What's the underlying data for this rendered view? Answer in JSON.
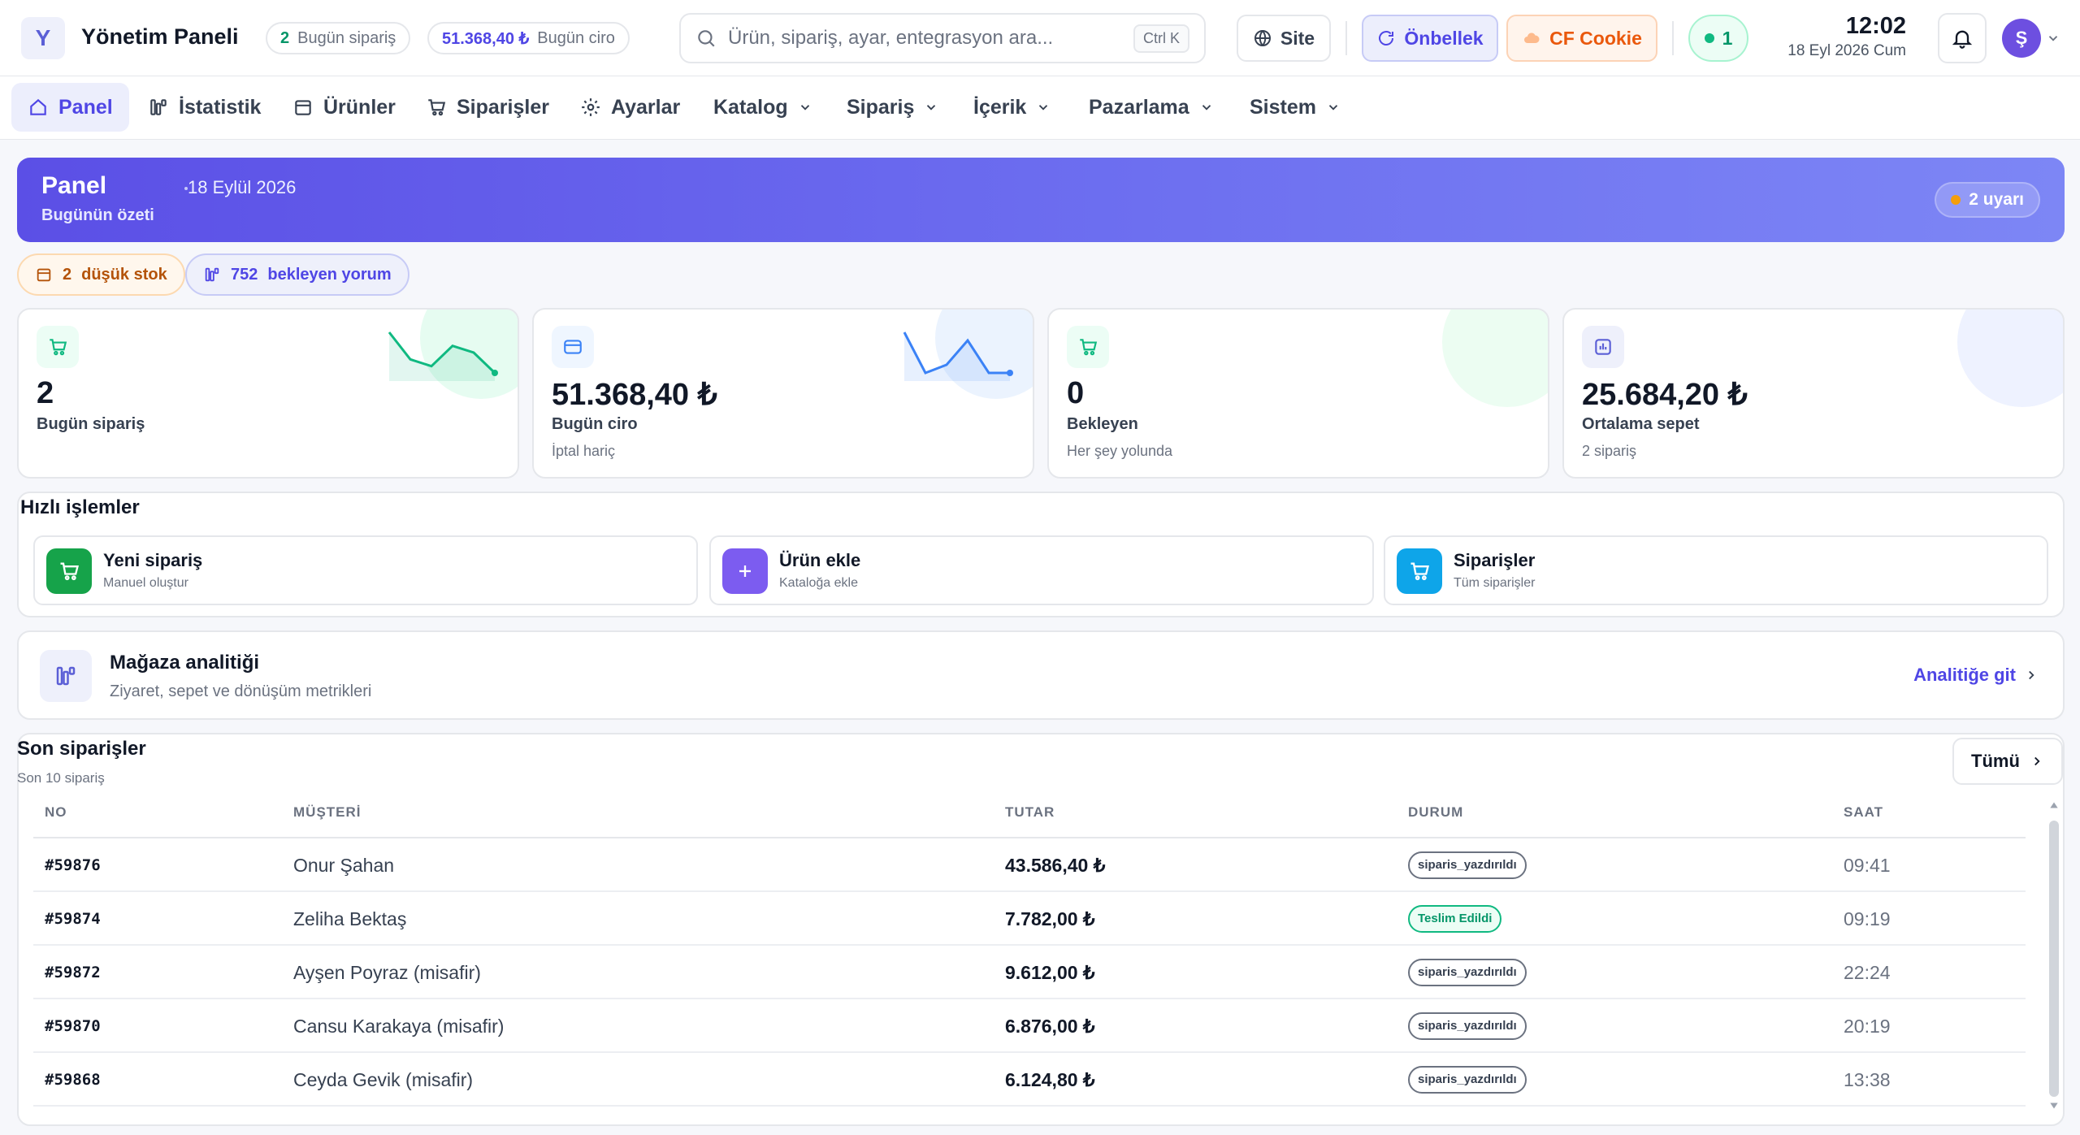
{
  "app": {
    "logo_letter": "Y",
    "title": "Yönetim Paneli",
    "today_orders_num": "2",
    "today_orders_label": "Bugün sipariş",
    "today_revenue_num": "51.368,40 ₺",
    "today_revenue_label": "Bugün ciro"
  },
  "search": {
    "placeholder": "Ürün, sipariş, ayar, entegrasyon ara...",
    "shortcut": "Ctrl K"
  },
  "toolbar": {
    "site_label": "Site",
    "cache_label": "Önbellek",
    "cookie_label": "CF Cookie",
    "online_count": "1",
    "time": "12:02",
    "date": "18 Eyl 2026 Cum",
    "avatar_letter": "Ş"
  },
  "nav": {
    "items": [
      {
        "label": "Panel"
      },
      {
        "label": "İstatistik"
      },
      {
        "label": "Ürünler"
      },
      {
        "label": "Siparişler"
      },
      {
        "label": "Ayarlar"
      },
      {
        "label": "Katalog"
      },
      {
        "label": "Sipariş"
      },
      {
        "label": "İçerik"
      },
      {
        "label": "Pazarlama"
      },
      {
        "label": "Sistem"
      }
    ]
  },
  "hero": {
    "title": "Panel",
    "date": "18 Eylül 2026",
    "subtitle": "Bugünün özeti",
    "warnings": "2 uyarı"
  },
  "alerts": {
    "low_stock_num": "2",
    "low_stock_label": "düşük stok",
    "reviews_num": "752",
    "reviews_label": "bekleyen yorum"
  },
  "stats": [
    {
      "value": "2",
      "label": "Bugün sipariş",
      "sub": "",
      "trend": [
        6,
        2,
        1,
        4,
        3,
        0
      ]
    },
    {
      "value": "51.368,40 ₺",
      "label": "Bugün ciro",
      "sub": "İptal hariç",
      "trend": [
        6,
        1,
        2,
        5,
        1,
        1
      ]
    },
    {
      "value": "0",
      "label": "Bekleyen",
      "sub": "Her şey yolunda"
    },
    {
      "value": "25.684,20 ₺",
      "label": "Ortalama sepet",
      "sub": "2 sipariş"
    }
  ],
  "quick_actions": {
    "title": "Hızlı işlemler",
    "items": [
      {
        "title": "Yeni sipariş",
        "sub": "Manuel oluştur"
      },
      {
        "title": "Ürün ekle",
        "sub": "Kataloğa ekle"
      },
      {
        "title": "Siparişler",
        "sub": "Tüm siparişler"
      }
    ]
  },
  "analytics": {
    "title": "Mağaza analitiği",
    "subtitle": "Ziyaret, sepet ve dönüşüm metrikleri",
    "link": "Analitiğe git"
  },
  "orders": {
    "title": "Son siparişler",
    "subtitle": "Son 10 sipariş",
    "all_label": "Tümü",
    "columns": [
      "NO",
      "MÜŞTERİ",
      "TUTAR",
      "DURUM",
      "SAAT"
    ],
    "rows": [
      {
        "no": "#59876",
        "customer": "Onur Şahan",
        "amount": "43.586,40 ₺",
        "status": "siparis_yazdırıldı",
        "time": "09:41"
      },
      {
        "no": "#59874",
        "customer": "Zeliha Bektaş",
        "amount": "7.782,00 ₺",
        "status": "Teslim Edildi",
        "time": "09:19"
      },
      {
        "no": "#59872",
        "customer": "Ayşen Poyraz (misafir)",
        "amount": "9.612,00 ₺",
        "status": "siparis_yazdırıldı",
        "time": "22:24"
      },
      {
        "no": "#59870",
        "customer": "Cansu Karakaya (misafir)",
        "amount": "6.876,00 ₺",
        "status": "siparis_yazdırıldı",
        "time": "20:19"
      },
      {
        "no": "#59868",
        "customer": "Ceyda Gevik (misafir)",
        "amount": "6.124,80 ₺",
        "status": "siparis_yazdırıldı",
        "time": "13:38"
      }
    ]
  },
  "colors": {
    "accent": "#4f46e5",
    "green": "#10b981",
    "blue": "#3b82f6"
  }
}
